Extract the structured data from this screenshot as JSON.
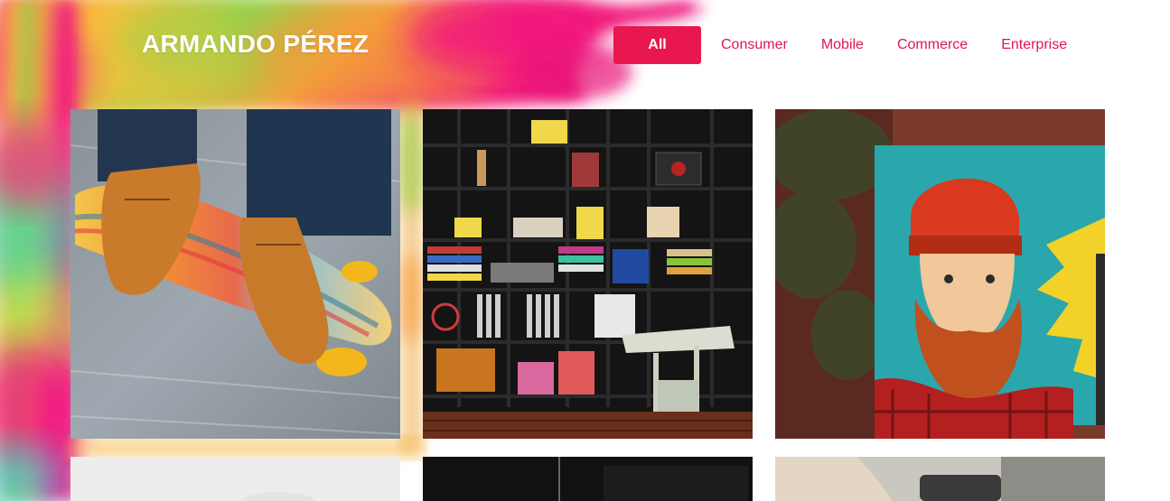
{
  "header": {
    "brand": "ARMANDO PÉREZ"
  },
  "filters": {
    "active": "All",
    "items": [
      "All",
      "Consumer",
      "Mobile",
      "Commerce",
      "Enterprise"
    ]
  },
  "colors": {
    "accent": "#e8174f",
    "filter_text": "#e0174f",
    "brand_text": "#ffffff"
  },
  "portfolio": {
    "items": [
      {
        "subject": "skateboard-sneakers-photo"
      },
      {
        "subject": "bookshelf-records-photo"
      },
      {
        "subject": "bearded-man-mural-photo"
      },
      {
        "subject": "white-object-photo"
      },
      {
        "subject": "dark-interior-photo"
      },
      {
        "subject": "hands-device-photo"
      }
    ]
  }
}
